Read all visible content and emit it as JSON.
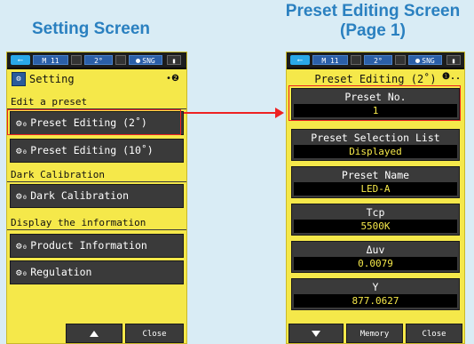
{
  "captions": {
    "left": "Setting Screen",
    "right_line1": "Preset Editing Screen",
    "right_line2": "(Page 1)"
  },
  "status_bar": {
    "mode": "M 11",
    "angle": "2°",
    "measure": "SNG"
  },
  "left_screen": {
    "title": "Setting",
    "page_indicator": "•❷",
    "sections": [
      {
        "header": "Edit a preset",
        "items": [
          "Preset Editing (2˚)",
          "Preset Editing (10˚)"
        ]
      },
      {
        "header": "Dark Calibration",
        "items": [
          "Dark Calibration"
        ]
      },
      {
        "header": "Display the information",
        "items": [
          "Product Information",
          "Regulation"
        ]
      }
    ],
    "bottom_bar": {
      "up_icon": "up-arrow-icon",
      "close": "Close"
    }
  },
  "right_screen": {
    "title": "Preset Editing (2˚)",
    "title_indicator": "❶..",
    "fields": [
      {
        "label": "Preset No.",
        "value": "1"
      },
      {
        "label": "Preset Selection List",
        "value": "Displayed"
      },
      {
        "label": "Preset Name",
        "value": "LED-A"
      },
      {
        "label": "Tcp",
        "value": "5500K"
      },
      {
        "label": "Δuv",
        "value": "0.0079"
      },
      {
        "label": "Y",
        "value": "877.0627"
      }
    ],
    "bottom_bar": {
      "down_icon": "down-arrow-icon",
      "memory": "Memory",
      "close": "Close"
    }
  },
  "colors": {
    "screen_bg": "#f5e84a",
    "button_bg": "#3a3a3a",
    "value_text": "#f5e84a",
    "highlight": "#e22222",
    "caption": "#2a80c0"
  }
}
